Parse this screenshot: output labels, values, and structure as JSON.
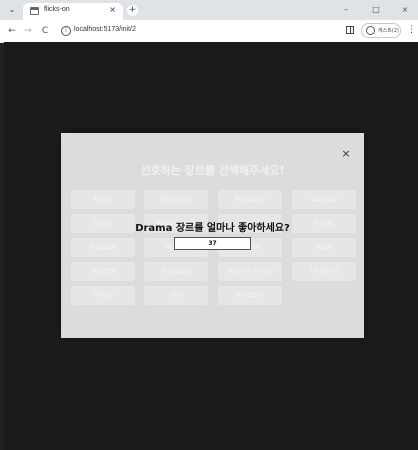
{
  "browser": {
    "tab_title": "flicks-on",
    "tab_close": "×",
    "new_tab": "+",
    "url": "localhost:5173/init/2",
    "profile_label": "게스트(2)",
    "nav": {
      "back": "←",
      "forward": "→",
      "reload": "C"
    },
    "window": {
      "minimize": "–",
      "maximize": "□",
      "close": "×"
    },
    "menu": "⋮",
    "tab_menu": "⌄"
  },
  "modal": {
    "close_label": "×",
    "title": "선호하는 장르를 선택해주세요!",
    "genres": [
      "Action",
      "Adventure",
      "Animation",
      "Comedy",
      "Crime",
      "Documentary",
      "Drama",
      "Family",
      "Fantasy",
      "History",
      "Horror",
      "Music",
      "Mystery",
      "Romance",
      "Science Fiction",
      "TV Movie",
      "Thriller",
      "War",
      "Western"
    ],
    "rating_question": "Drama 장르를 얼마나 좋아하세요?",
    "rating_value": "37"
  }
}
